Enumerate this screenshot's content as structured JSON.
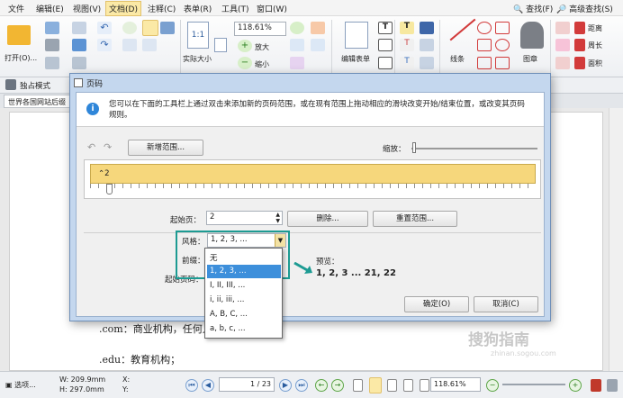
{
  "menu": [
    "文件",
    "编辑(E)",
    "视图(V)",
    "文档(D)",
    "注释(C)",
    "表单(R)",
    "工具(T)",
    "窗口(W)"
  ],
  "menu_active_index": 3,
  "ribbon": {
    "open_label": "打开(O)...",
    "zoom_value": "118.61%",
    "actual_size": "实际大小",
    "zoom_in": "放大",
    "zoom_out": "缩小",
    "edit_form": "编辑表单",
    "lines": "线条",
    "stamp": "图章",
    "distance": "距离",
    "perimeter": "周长",
    "area": "面积",
    "find": "查找(F)",
    "advanced_find": "高级查找(S)"
  },
  "toolbar2": {
    "exclusive_mode": "独占模式"
  },
  "doc_tab": "世界各国网站后缀",
  "document_lines": [
    ".com：商业机构，任何人都可以注册；",
    ".edu：教育机构；"
  ],
  "dialog": {
    "title": "页码",
    "info": "您可以在下面的工具栏上通过双击来添加新的页码范围，或在现有范围上拖动相应的滑块改变开始/结束位置，或改变其页码规则。",
    "new_range": "新增范围...",
    "zoom_label": "缩放：",
    "range_marker": "2",
    "start_page_label": "起始页：",
    "start_page_value": "2",
    "delete": "删除...",
    "reset": "重置范围...",
    "style_label": "风格：",
    "style_value": "1, 2, 3, ...",
    "prefix_label": "前缀：",
    "start_number_label": "起始页码：",
    "preview_label": "预览：",
    "preview_value": "1, 2, 3 ... 21, 22",
    "style_options": [
      "无",
      "1, 2, 3, ...",
      "I, II, III, ...",
      "i, ii, iii, ...",
      "A, B, C, ...",
      "a, b, c, ..."
    ],
    "selected_option_index": 1,
    "ok": "确定(O)",
    "cancel": "取消(C)"
  },
  "status": {
    "options": "选项...",
    "width": "W: 209.9mm",
    "height": "H: 297.0mm",
    "x": "X:",
    "y": "Y:",
    "page": "1",
    "page_total": "/ 23",
    "zoom": "118.61%"
  },
  "watermark": "搜狗指南",
  "watermark_url": "zhinan.sogou.com",
  "colors": {
    "accent": "#1d9b93",
    "selection": "#3d8fdb",
    "range_bar": "#f6d77c"
  }
}
